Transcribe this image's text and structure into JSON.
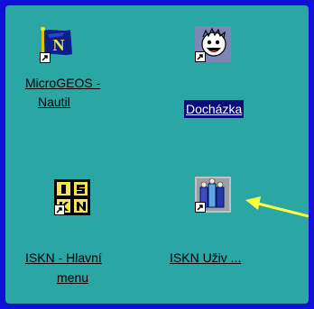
{
  "desktop": {
    "background_color": "#2aa6a4",
    "frame_color": "#1010d8",
    "icons": [
      {
        "label_line1": "MicroGEOS -",
        "label_line2": "Nautil",
        "icon": "microgeos-flag-icon",
        "selected": false
      },
      {
        "label_line1": "Docházka",
        "label_line2": "",
        "icon": "dochazka-face-icon",
        "selected": true
      },
      {
        "label_line1": "ISKN - Hlavní",
        "label_line2": "menu",
        "icon": "iskn-logo-icon",
        "selected": false
      },
      {
        "label_line1": "ISKN  Uživ  ...",
        "label_line2": "",
        "icon": "iskn-users-icon",
        "selected": false
      }
    ]
  },
  "annotation": {
    "arrow_color": "#ffff40",
    "icon": "pointer-arrow-icon"
  }
}
